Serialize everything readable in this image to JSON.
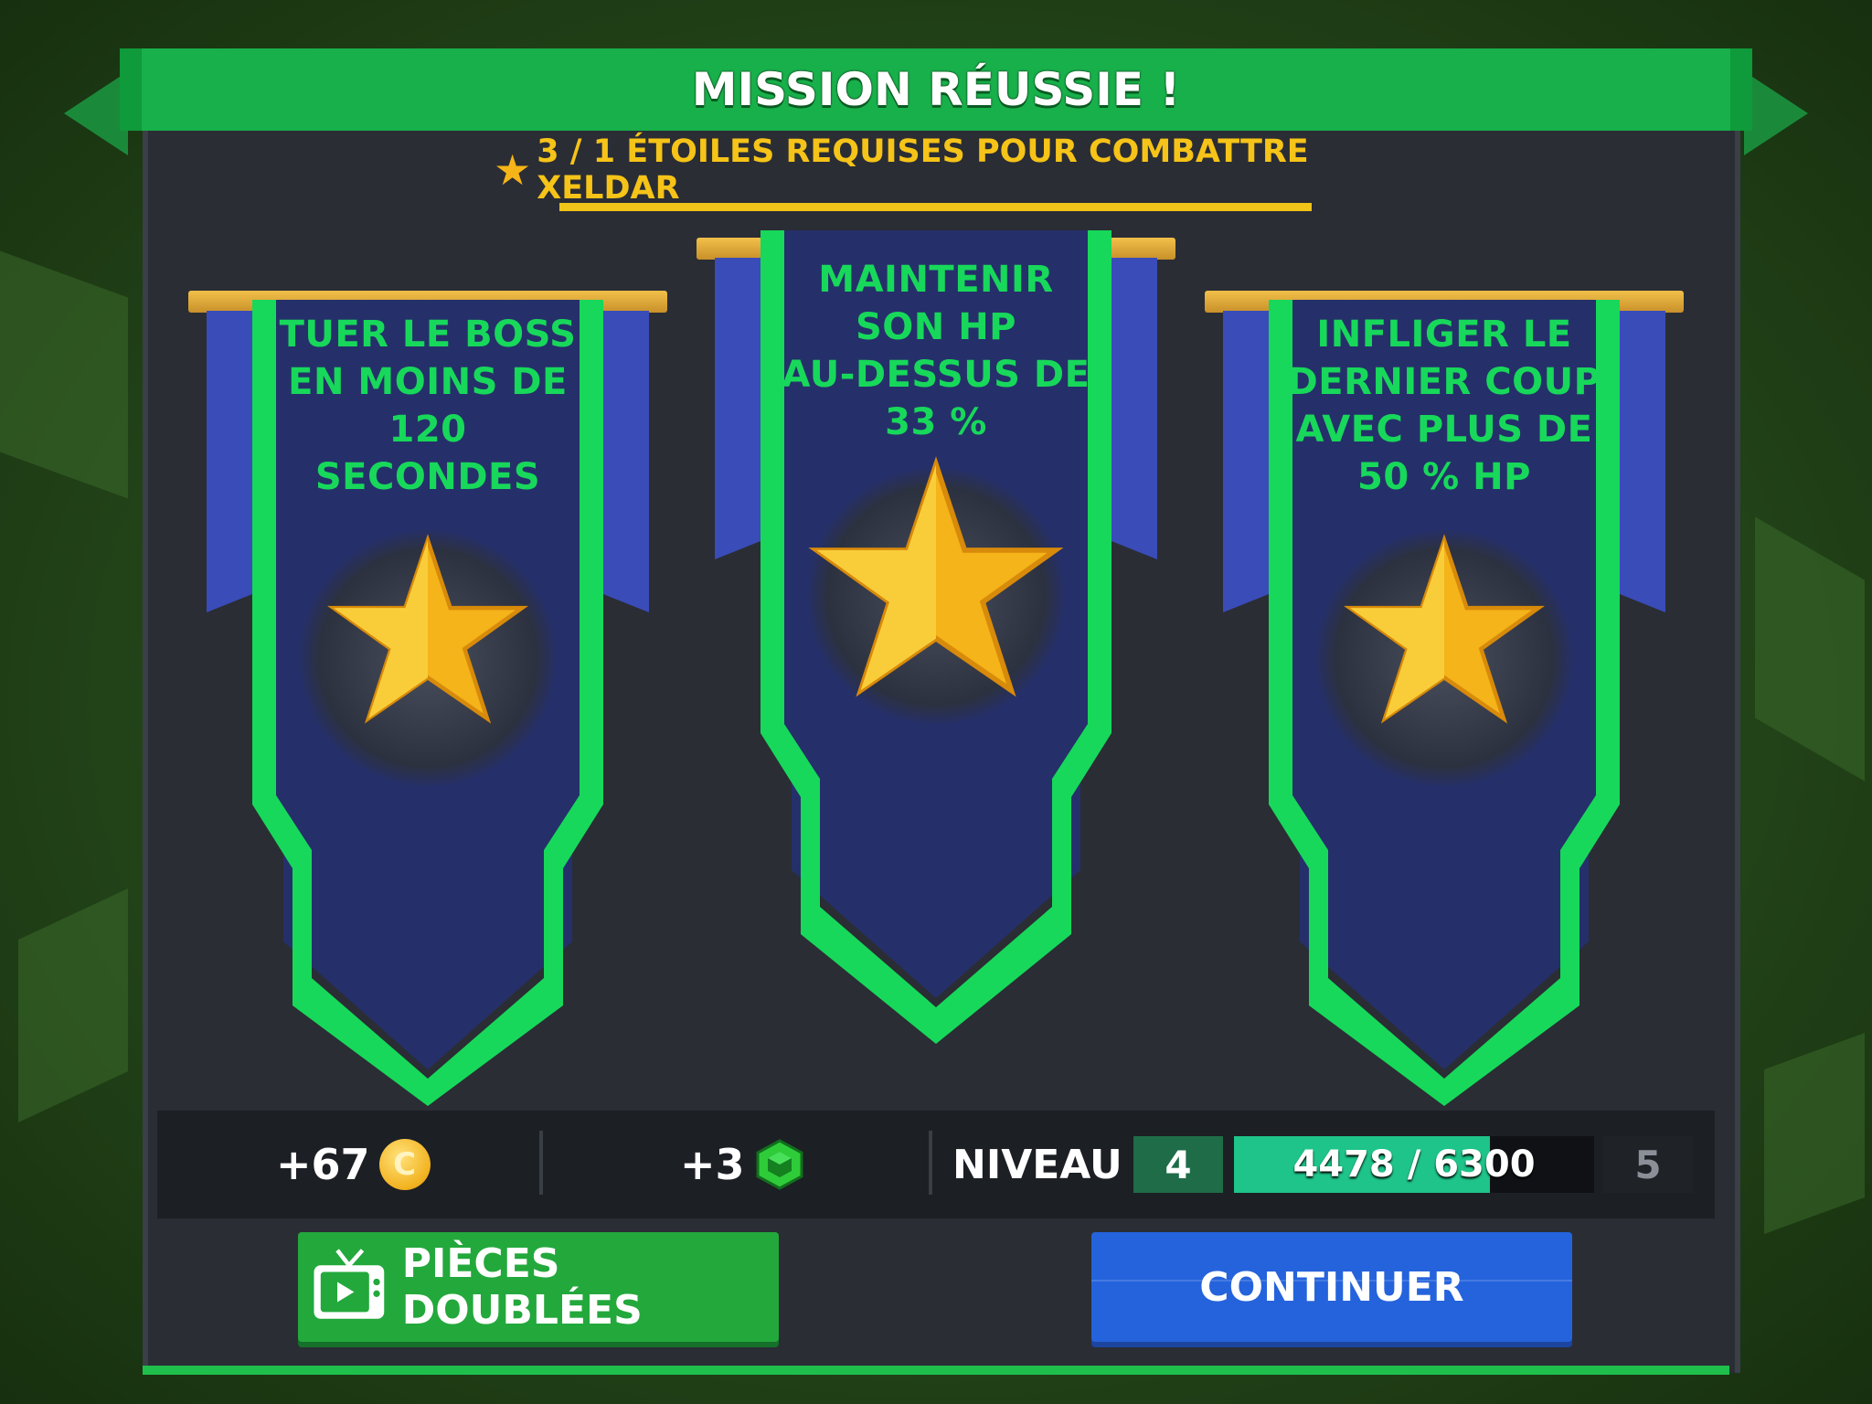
{
  "title": "MISSION RÉUSSIE !",
  "requirement": {
    "icon": "star-icon",
    "text": "3 / 1 ÉTOILES REQUISES POUR COMBATTRE XELDAR"
  },
  "banners": [
    {
      "text_lines": [
        "TUER LE BOSS",
        "EN MOINS DE",
        "120",
        "SECONDES"
      ],
      "star_earned": true
    },
    {
      "text_lines": [
        "MAINTENIR",
        "SON HP",
        "AU-DESSUS DE",
        "33 %"
      ],
      "star_earned": true
    },
    {
      "text_lines": [
        "INFLIGER LE",
        "DERNIER COUP",
        "AVEC PLUS DE",
        "50 % HP"
      ],
      "star_earned": true
    }
  ],
  "rewards": {
    "coins": "+67",
    "coin_icon": "coin-icon",
    "coin_symbol": "C",
    "gems": "+3",
    "gem_icon": "gem-icon"
  },
  "level": {
    "label": "NIVEAU",
    "current": "4",
    "next": "5",
    "xp_text": "4478 / 6300",
    "xp_fraction": 0.711
  },
  "buttons": {
    "double_coins": "PIÈCES DOUBLÉES",
    "double_coins_icon": "tv-play-icon",
    "continue": "CONTINUER"
  },
  "colors": {
    "title_green": "#18b04a",
    "banner_green": "#17d85a",
    "banner_blue": "#25306a",
    "requirement_yellow": "#f6c318",
    "continue_blue": "#2563dc",
    "xp_fill": "#1ec48a"
  }
}
